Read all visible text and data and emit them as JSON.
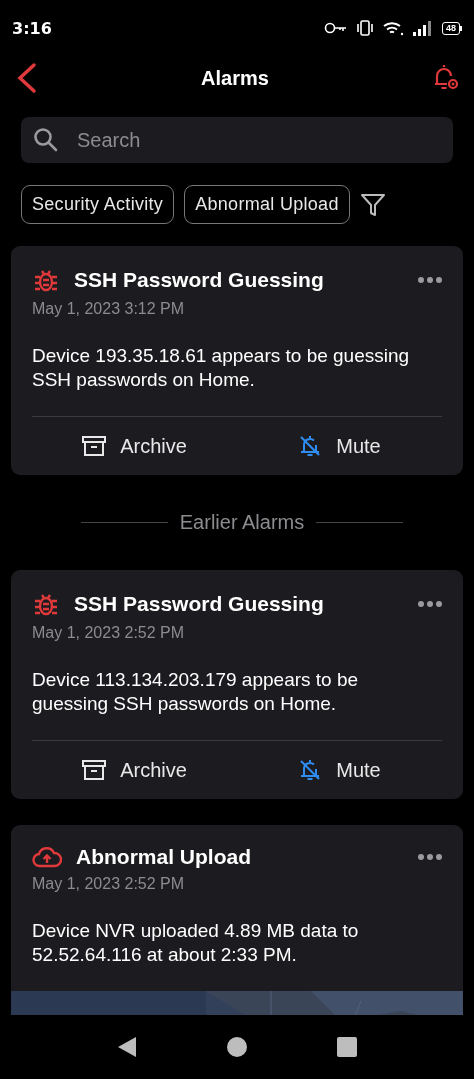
{
  "status_bar": {
    "time": "3:16",
    "battery": "48"
  },
  "header": {
    "title": "Alarms"
  },
  "search": {
    "placeholder": "Search"
  },
  "filters": [
    {
      "label": "Security Activity"
    },
    {
      "label": "Abnormal Upload"
    }
  ],
  "feed": [
    {
      "kind": "security",
      "title": "SSH Password Guessing",
      "time": "May 1, 2023 3:12 PM",
      "body": "Device 193.35.18.61 appears to be guessing SSH passwords on Home.",
      "actions": [
        {
          "kind": "archive",
          "label": "Archive"
        },
        {
          "kind": "mute",
          "label": "Mute"
        }
      ]
    },
    {
      "kind": "divider",
      "label": "Earlier Alarms"
    },
    {
      "kind": "security",
      "title": "SSH Password Guessing",
      "time": "May 1, 2023 2:52 PM",
      "body": "Device 113.134.203.179 appears to be guessing SSH passwords on Home.",
      "actions": [
        {
          "kind": "archive",
          "label": "Archive"
        },
        {
          "kind": "mute",
          "label": "Mute"
        }
      ]
    },
    {
      "kind": "upload",
      "title": "Abnormal Upload",
      "time": "May 1, 2023 2:52 PM",
      "body": "Device NVR uploaded 4.89 MB data to 52.52.64.116 at about 2:33 PM."
    }
  ]
}
